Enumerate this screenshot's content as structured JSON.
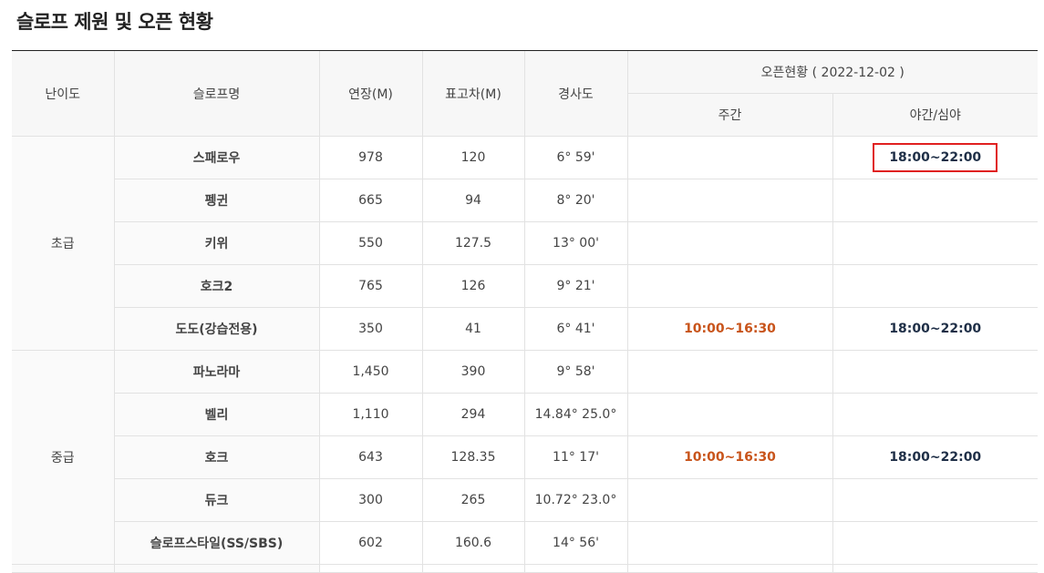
{
  "page": {
    "title": "슬로프 제원 및 오픈 현황"
  },
  "header": {
    "level": "난이도",
    "name": "슬로프명",
    "length": "연장(M)",
    "elevation": "표고차(M)",
    "slope": "경사도",
    "open_status": "오픈현황 ( 2022-12-02 )",
    "day": "주간",
    "night": "야간/심야"
  },
  "groups": {
    "beginner": "초급",
    "intermediate": "중급"
  },
  "rows": [
    {
      "name": "스패로우",
      "length": "978",
      "elevation": "120",
      "slope": "6° 59'",
      "day": "",
      "night": "18:00~22:00"
    },
    {
      "name": "펭귄",
      "length": "665",
      "elevation": "94",
      "slope": "8° 20'",
      "day": "",
      "night": ""
    },
    {
      "name": "키위",
      "length": "550",
      "elevation": "127.5",
      "slope": "13° 00'",
      "day": "",
      "night": ""
    },
    {
      "name": "호크2",
      "length": "765",
      "elevation": "126",
      "slope": "9° 21'",
      "day": "",
      "night": ""
    },
    {
      "name": "도도(강습전용)",
      "length": "350",
      "elevation": "41",
      "slope": "6° 41'",
      "day": "10:00~16:30",
      "night": "18:00~22:00"
    },
    {
      "name": "파노라마",
      "length": "1,450",
      "elevation": "390",
      "slope": "9° 58'",
      "day": "",
      "night": ""
    },
    {
      "name": "벨리",
      "length": "1,110",
      "elevation": "294",
      "slope": "14.84° 25.0°",
      "day": "",
      "night": ""
    },
    {
      "name": "호크",
      "length": "643",
      "elevation": "128.35",
      "slope": "11° 17'",
      "day": "10:00~16:30",
      "night": "18:00~22:00"
    },
    {
      "name": "듀크",
      "length": "300",
      "elevation": "265",
      "slope": "10.72° 23.0°",
      "day": "",
      "night": ""
    },
    {
      "name": "슬로프스타일(SS/SBS)",
      "length": "602",
      "elevation": "160.6",
      "slope": "14° 56'",
      "day": "",
      "night": ""
    }
  ],
  "colors": {
    "highlight_border": "#e02020",
    "day_time": "#c8541b",
    "night_time": "#1f2f47"
  }
}
